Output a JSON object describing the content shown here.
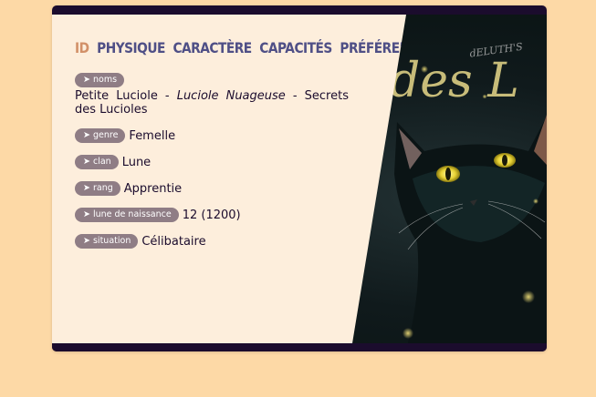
{
  "tabs": [
    {
      "label": "ID",
      "active": true
    },
    {
      "label": "PHYSIQUE",
      "active": false
    },
    {
      "label": "CARACTÈRE",
      "active": false
    },
    {
      "label": "CAPACITÉS",
      "active": false
    },
    {
      "label": "PRÉFÉRENCES",
      "active": false
    }
  ],
  "fields": {
    "noms": {
      "label": "➤ noms",
      "part1": "Petite Luciole",
      "sep1": " - ",
      "part2": "Luciole Nuageuse",
      "sep2": " - ",
      "part3": "Secrets des Lucioles"
    },
    "genre": {
      "label": "➤ genre",
      "value": "Femelle"
    },
    "clan": {
      "label": "➤ clan",
      "value": "Lune"
    },
    "rang": {
      "label": "➤ rang",
      "value": "Apprentie"
    },
    "lune": {
      "label": "➤ lune de naissance",
      "value": "12 (1200)"
    },
    "situation": {
      "label": "➤ situation",
      "value": "Célibataire"
    }
  },
  "artwork": {
    "script_text": "des L",
    "credit_text": "dELUTH'S"
  },
  "colors": {
    "page_bg": "#fdd9a6",
    "panel_bg": "#fdeedc",
    "frame": "#1b0c2d",
    "tab": "#4f4f86",
    "tab_active": "#d29068",
    "badge": "#8f7d85",
    "cat_eyes": "#e9d335"
  }
}
